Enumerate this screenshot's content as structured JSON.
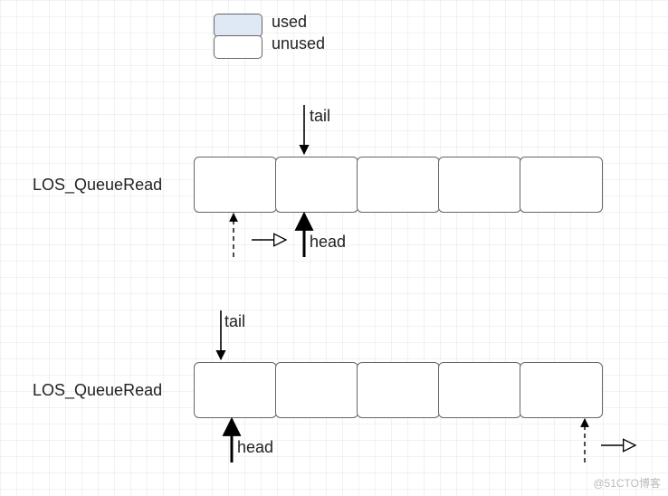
{
  "legend": {
    "used_label": "used",
    "unused_label": "unused"
  },
  "diagram1": {
    "title": "LOS_QueueRead",
    "tail_label": "tail",
    "head_label": "head"
  },
  "diagram2": {
    "title": "LOS_QueueRead",
    "tail_label": "tail",
    "head_label": "head"
  },
  "watermark": "@51CTO博客",
  "chart_data": [
    {
      "type": "table",
      "title": "Queue state (upper diagram)",
      "cells": [
        {
          "index": 0,
          "state": "unused"
        },
        {
          "index": 1,
          "state": "unused"
        },
        {
          "index": 2,
          "state": "unused"
        },
        {
          "index": 3,
          "state": "unused"
        },
        {
          "index": 4,
          "state": "unused"
        }
      ],
      "tail_index": 1,
      "head_index": 1,
      "direction": "right"
    },
    {
      "type": "table",
      "title": "Queue state (lower diagram)",
      "cells": [
        {
          "index": 0,
          "state": "unused"
        },
        {
          "index": 1,
          "state": "unused"
        },
        {
          "index": 2,
          "state": "unused"
        },
        {
          "index": 3,
          "state": "unused"
        },
        {
          "index": 4,
          "state": "unused"
        }
      ],
      "tail_index": 0,
      "head_index": 0,
      "direction": "right"
    }
  ]
}
